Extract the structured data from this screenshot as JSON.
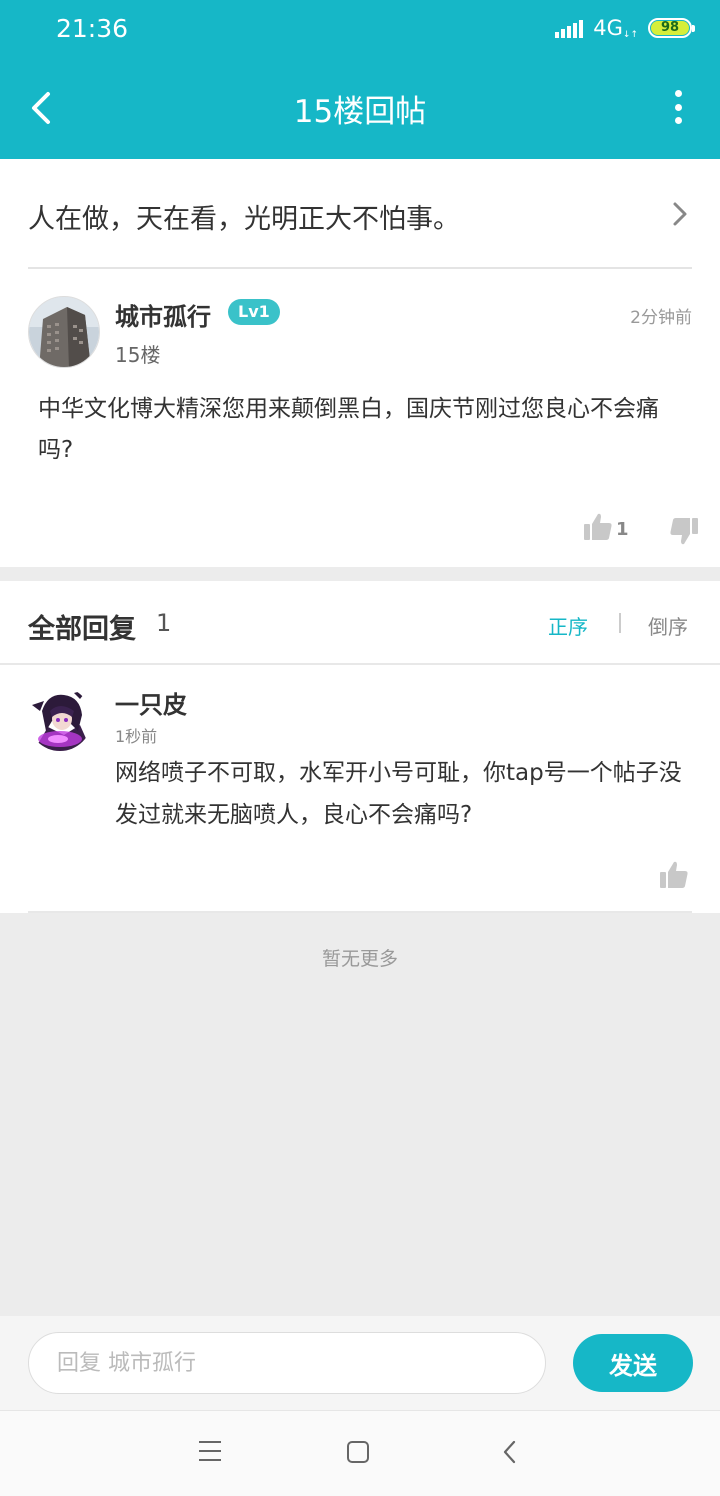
{
  "status_bar": {
    "time": "21:36",
    "network": "4G",
    "battery": "98"
  },
  "header": {
    "title": "15楼回帖"
  },
  "topic": {
    "text": "人在做，天在看，光明正大不怕事。"
  },
  "post": {
    "author": "城市孤行",
    "level": "Lv1",
    "floor": "15楼",
    "time": "2分钟前",
    "content": "中华文化博大精深您用来颠倒黑白，国庆节刚过您良心不会痛吗?",
    "likes": "1"
  },
  "replies": {
    "title": "全部回复",
    "count": "1",
    "sort_asc": "正序",
    "sort_desc": "倒序",
    "items": [
      {
        "author": "一只皮",
        "time": "1秒前",
        "content": "网络喷子不可取，水军开小号可耻，你tap号一个帖子没发过就来无脑喷人，良心不会痛吗?"
      }
    ]
  },
  "no_more": "暂无更多",
  "reply_bar": {
    "placeholder": "回复 城市孤行",
    "send_label": "发送"
  },
  "colors": {
    "accent": "#16b7c7",
    "level_badge": "#3ac2c9"
  }
}
